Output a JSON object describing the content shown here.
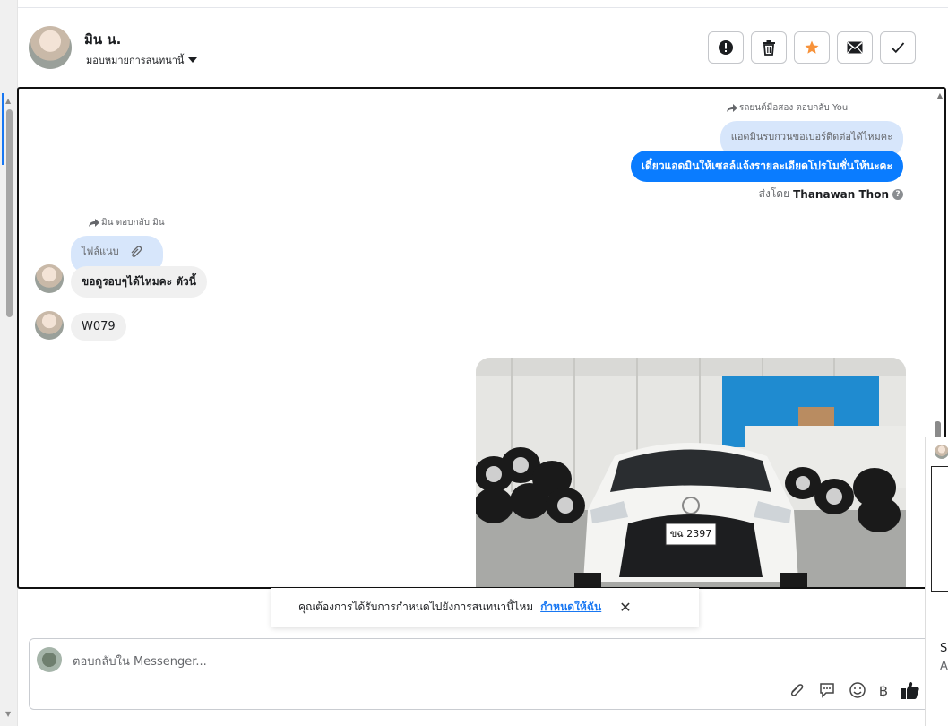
{
  "header": {
    "contact_name": "มิน น.",
    "assign_label": "มอบหมายการสนทนานี้",
    "actions": [
      "report-icon",
      "trash-icon",
      "star-icon",
      "mail-icon",
      "check-icon"
    ],
    "star_color": "#f7923a"
  },
  "messages": {
    "outgoing_reply_note": "รถยนต์มือสอง ตอบกลับ You",
    "outgoing_quoted": "แอดมินรบกวนขอเบอร์ติดต่อได้ไหมคะ",
    "outgoing_text": "เดี๋ยวแอดมินให้เซลล์แจ้งรายละเอียดโปรโมชั่นให้นะคะ",
    "sent_by_prefix": "ส่งโดย",
    "sent_by_name": "Thanawan Thon",
    "incoming_reply_note": "มิน ตอบกลับ มิน",
    "incoming_quoted": "ไฟล์แนบ",
    "incoming_text_1": "ขอดูรอบๆได้ไหมคะ ตัวนี้",
    "incoming_text_2": "W079",
    "photo_plate": "ขฉ 2397"
  },
  "banner": {
    "question": "คุณต้องการได้รับการกำหนดไปยังการสนทนานี้ไหม",
    "link": "กำหนดให้ฉัน"
  },
  "composer": {
    "placeholder": "ตอบกลับใน Messenger...",
    "tools": [
      "attach-icon",
      "saved-reply-icon",
      "emoji-icon",
      "baht-icon",
      "like-icon"
    ],
    "baht_symbol": "฿"
  },
  "right_edge": {
    "line1": "S(",
    "line2": "A"
  },
  "colors": {
    "outgoing_bubble": "#0a7cff",
    "quoted_bubble": "#d7e6fb",
    "incoming_bubble": "#f0f0f0",
    "link": "#1877f2"
  }
}
